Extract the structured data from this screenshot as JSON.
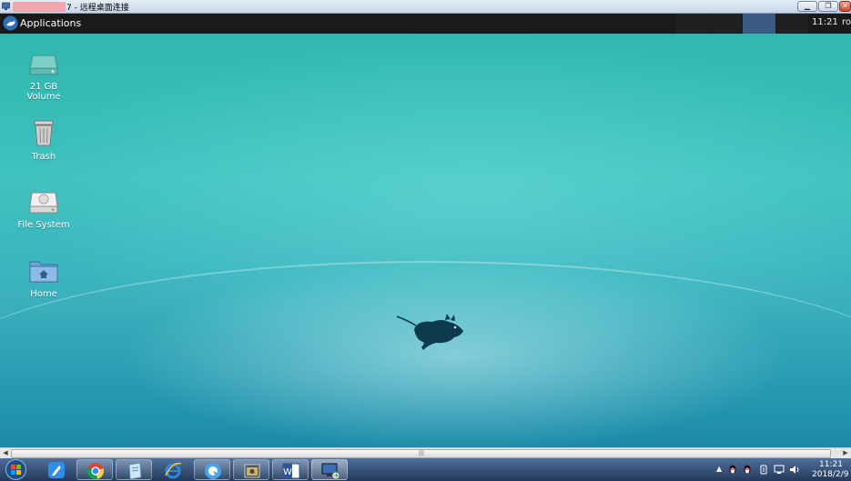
{
  "rdp_window": {
    "title": "7 - 远程桌面连接",
    "buttons": [
      "minimize",
      "restore",
      "close"
    ]
  },
  "xfce_panel": {
    "applications_label": "Applications",
    "clock": "11:21",
    "user": "ro"
  },
  "desktop_icons": [
    {
      "label": "21 GB\nVolume",
      "icon": "drive-icon"
    },
    {
      "label": "Trash",
      "icon": "trash-icon"
    },
    {
      "label": "File System",
      "icon": "filesystem-icon"
    },
    {
      "label": "Home",
      "icon": "home-folder-icon"
    }
  ],
  "wallpaper": {
    "logo": "xfce-mouse-logo",
    "colors": [
      "#2fb7b0",
      "#1b8aa8"
    ]
  },
  "taskbar": {
    "pinned": [
      "start-orb-icon",
      "notes-app-icon",
      "chrome-icon",
      "notepad-icon",
      "ie-icon",
      "browser-app-icon",
      "media-icon",
      "word-icon",
      "remote-desktop-icon"
    ],
    "tray_time": "11:21",
    "tray_date": "2018/2/9"
  }
}
